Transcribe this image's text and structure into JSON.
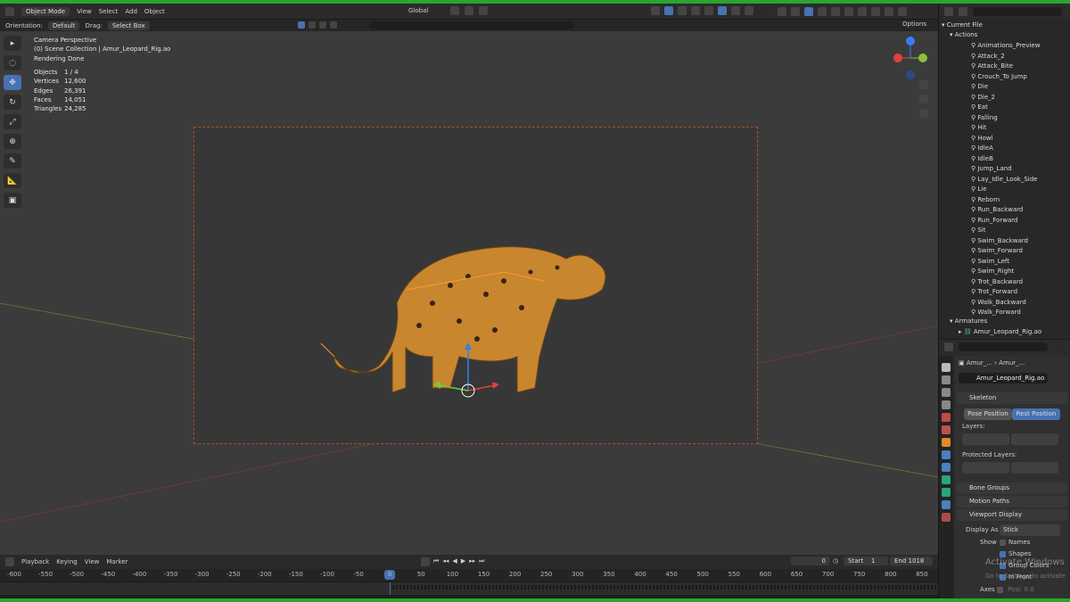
{
  "header": {
    "mode": "Object Mode",
    "menus": [
      "View",
      "Select",
      "Add",
      "Object"
    ],
    "transform_space": "Global",
    "orientation_label": "Orientation:",
    "orientation_value": "Default",
    "drag_label": "Drag:",
    "drag_value": "Select Box",
    "options": "Options"
  },
  "viewport": {
    "view_name": "Camera Perspective",
    "collection": "(0) Scene Collection | Amur_Leopard_Rig.ao",
    "render_status": "Rendering Done",
    "stats": [
      {
        "label": "Objects",
        "value": "1 / 4"
      },
      {
        "label": "Vertices",
        "value": "12,600"
      },
      {
        "label": "Edges",
        "value": "26,391"
      },
      {
        "label": "Faces",
        "value": "14,051"
      },
      {
        "label": "Triangles",
        "value": "24,285"
      }
    ]
  },
  "timeline": {
    "menus": [
      "Playback",
      "Keying",
      "View",
      "Marker"
    ],
    "current_frame": "0",
    "start_label": "Start",
    "start": "1",
    "end_label": "End",
    "end": "1018",
    "ticks": [
      "-600",
      "-550",
      "-500",
      "-450",
      "-400",
      "-350",
      "-300",
      "-250",
      "-200",
      "-150",
      "-100",
      "-50",
      "0",
      "50",
      "100",
      "150",
      "200",
      "250",
      "300",
      "350",
      "400",
      "450",
      "500",
      "550",
      "600",
      "650",
      "700",
      "750",
      "800",
      "850"
    ]
  },
  "outliner": {
    "root": "Current File",
    "actions_label": "Actions",
    "actions": [
      "Animations_Preview",
      "Attack_2",
      "Attack_Bite",
      "Crouch_To Jump",
      "Die",
      "Die_2",
      "Eat",
      "Falling",
      "Hit",
      "Howl",
      "IdleA",
      "IdleB",
      "Jump_Land",
      "Lay_Idle_Look_Side",
      "Lie",
      "Reborn",
      "Run_Backward",
      "Run_Forward",
      "Sit",
      "Swim_Backward",
      "Swim_Forward",
      "Swim_Left",
      "Swim_Right",
      "Trot_Backward",
      "Trot_Forward",
      "Walk_Backward",
      "Walk_Forward"
    ],
    "armatures_label": "Armatures",
    "armature": "Amur_Leopard_Rig.ao"
  },
  "properties": {
    "breadcrumb_1": "Amur_...",
    "breadcrumb_2": "Amur_...",
    "name": "Amur_Leopard_Rig.ao",
    "skeleton": "Skeleton",
    "pose_position": "Pose Position",
    "rest_position": "Rest Position",
    "layers": "Layers:",
    "protected_layers": "Protected Layers:",
    "bone_groups": "Bone Groups",
    "motion_paths": "Motion Paths",
    "viewport_display": "Viewport Display",
    "display_as_label": "Display As",
    "display_as": "Stick",
    "show_label": "Show",
    "names": "Names",
    "shapes": "Shapes",
    "group_colors": "Group Colors",
    "in_front": "In Front",
    "axes": "Axes",
    "position_label": "Posi: 0.0",
    "watermark": "Activate Windows",
    "watermark_sub": "Go to Settings to activate"
  },
  "colors": {
    "accent": "#4772b3",
    "frame_border": "#b04b2a",
    "outer_bar": "#2aa52f"
  }
}
